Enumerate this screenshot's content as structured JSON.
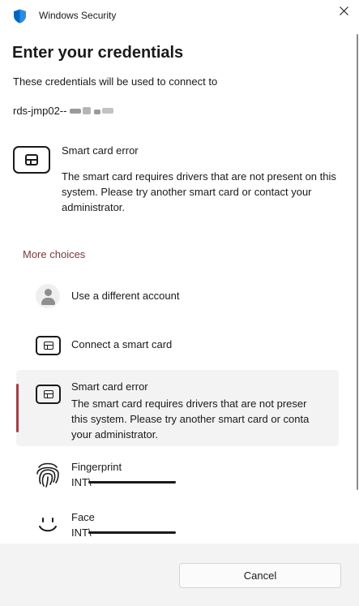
{
  "window": {
    "title": "Windows Security"
  },
  "heading": "Enter your credentials",
  "subtitle": "These credentials will be used to connect to",
  "target_host": "rds-jmp02--",
  "error": {
    "title": "Smart card error",
    "body": "The smart card requires drivers that are not present on this system. Please try another smart card or contact your administrator."
  },
  "more_choices": "More choices",
  "choices": [
    {
      "label": "Use a different account",
      "icon": "person-icon"
    },
    {
      "label": "Connect a smart card",
      "icon": "smart-card-icon"
    },
    {
      "label": "Smart card error",
      "detail": "The smart card requires drivers that are not preser this system. Please try another smart card or conta your administrator.",
      "icon": "smart-card-icon",
      "selected": true
    },
    {
      "label": "Fingerprint",
      "account": "INT\\",
      "icon": "fingerprint-icon"
    },
    {
      "label": "Face",
      "account": "INT\\",
      "icon": "face-icon"
    }
  ],
  "footer": {
    "cancel_label": "Cancel"
  },
  "colors": {
    "accent": "#a83c44",
    "link": "#7a3b3b",
    "footer_bg": "#f3f3f3"
  }
}
